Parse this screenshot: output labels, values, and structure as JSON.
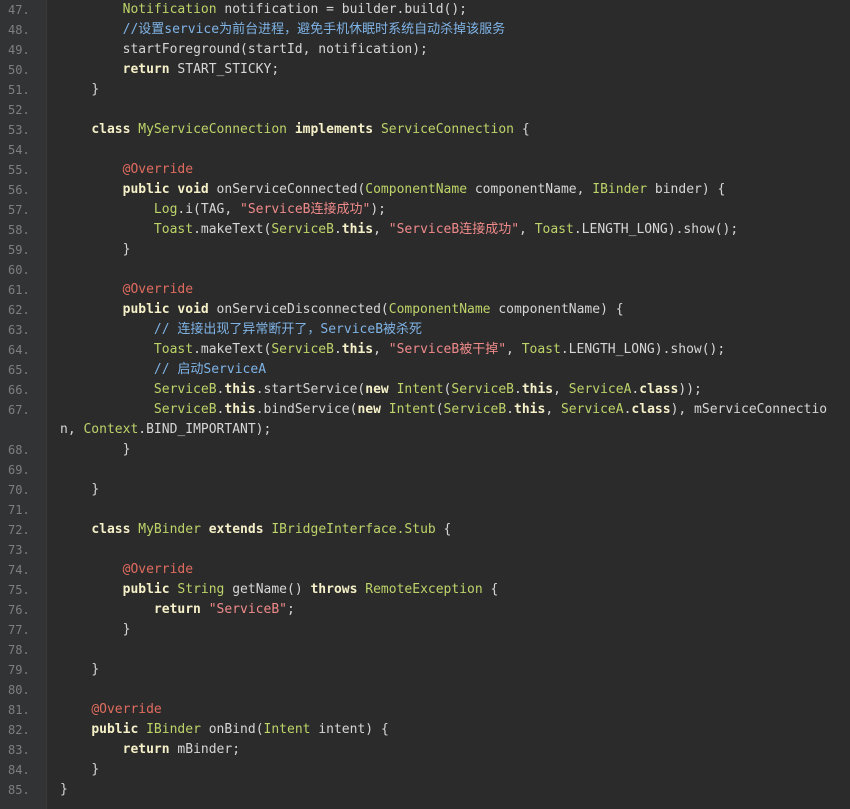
{
  "lines": [
    {
      "n": "47.",
      "indent": 2,
      "tokens": [
        [
          "t",
          "Notification"
        ],
        [
          "p",
          " notification = builder.build();"
        ]
      ]
    },
    {
      "n": "48.",
      "indent": 2,
      "tokens": [
        [
          "c",
          "//设置service为前台进程，避免手机休眠时系统自动杀掉该服务"
        ]
      ]
    },
    {
      "n": "49.",
      "indent": 2,
      "tokens": [
        [
          "p",
          "startForeground(startId, notification);"
        ]
      ]
    },
    {
      "n": "50.",
      "indent": 2,
      "tokens": [
        [
          "k",
          "return"
        ],
        [
          "p",
          " START_STICKY;"
        ]
      ]
    },
    {
      "n": "51.",
      "indent": 1,
      "tokens": [
        [
          "p",
          "}"
        ]
      ]
    },
    {
      "n": "52.",
      "indent": 0,
      "tokens": []
    },
    {
      "n": "53.",
      "indent": 1,
      "tokens": [
        [
          "k",
          "class"
        ],
        [
          "p",
          " "
        ],
        [
          "t",
          "MyServiceConnection"
        ],
        [
          "p",
          " "
        ],
        [
          "k",
          "implements"
        ],
        [
          "p",
          " "
        ],
        [
          "t",
          "ServiceConnection"
        ],
        [
          "p",
          " {"
        ]
      ]
    },
    {
      "n": "54.",
      "indent": 0,
      "tokens": []
    },
    {
      "n": "55.",
      "indent": 2,
      "tokens": [
        [
          "a",
          "@Override"
        ]
      ]
    },
    {
      "n": "56.",
      "indent": 2,
      "tokens": [
        [
          "k",
          "public"
        ],
        [
          "p",
          " "
        ],
        [
          "k",
          "void"
        ],
        [
          "p",
          " onServiceConnected("
        ],
        [
          "t",
          "ComponentName"
        ],
        [
          "p",
          " componentName, "
        ],
        [
          "t",
          "IBinder"
        ],
        [
          "p",
          " binder) {"
        ]
      ]
    },
    {
      "n": "57.",
      "indent": 3,
      "tokens": [
        [
          "t",
          "Log"
        ],
        [
          "p",
          ".i(TAG, "
        ],
        [
          "s",
          "\"ServiceB连接成功\""
        ],
        [
          "p",
          ");"
        ]
      ]
    },
    {
      "n": "58.",
      "indent": 3,
      "tokens": [
        [
          "t",
          "Toast"
        ],
        [
          "p",
          ".makeText("
        ],
        [
          "t",
          "ServiceB"
        ],
        [
          "p",
          "."
        ],
        [
          "k",
          "this"
        ],
        [
          "p",
          ", "
        ],
        [
          "s",
          "\"ServiceB连接成功\""
        ],
        [
          "p",
          ", "
        ],
        [
          "t",
          "Toast"
        ],
        [
          "p",
          ".LENGTH_LONG).show();"
        ]
      ]
    },
    {
      "n": "59.",
      "indent": 2,
      "tokens": [
        [
          "p",
          "}"
        ]
      ]
    },
    {
      "n": "60.",
      "indent": 0,
      "tokens": []
    },
    {
      "n": "61.",
      "indent": 2,
      "tokens": [
        [
          "a",
          "@Override"
        ]
      ]
    },
    {
      "n": "62.",
      "indent": 2,
      "tokens": [
        [
          "k",
          "public"
        ],
        [
          "p",
          " "
        ],
        [
          "k",
          "void"
        ],
        [
          "p",
          " onServiceDisconnected("
        ],
        [
          "t",
          "ComponentName"
        ],
        [
          "p",
          " componentName) {"
        ]
      ]
    },
    {
      "n": "63.",
      "indent": 3,
      "tokens": [
        [
          "c",
          "// 连接出现了异常断开了，ServiceB被杀死"
        ]
      ]
    },
    {
      "n": "64.",
      "indent": 3,
      "tokens": [
        [
          "t",
          "Toast"
        ],
        [
          "p",
          ".makeText("
        ],
        [
          "t",
          "ServiceB"
        ],
        [
          "p",
          "."
        ],
        [
          "k",
          "this"
        ],
        [
          "p",
          ", "
        ],
        [
          "s",
          "\"ServiceB被干掉\""
        ],
        [
          "p",
          ", "
        ],
        [
          "t",
          "Toast"
        ],
        [
          "p",
          ".LENGTH_LONG).show();"
        ]
      ]
    },
    {
      "n": "65.",
      "indent": 3,
      "tokens": [
        [
          "c",
          "// 启动ServiceA"
        ]
      ]
    },
    {
      "n": "66.",
      "indent": 3,
      "tokens": [
        [
          "t",
          "ServiceB"
        ],
        [
          "p",
          "."
        ],
        [
          "k",
          "this"
        ],
        [
          "p",
          ".startService("
        ],
        [
          "k",
          "new"
        ],
        [
          "p",
          " "
        ],
        [
          "t",
          "Intent"
        ],
        [
          "p",
          "("
        ],
        [
          "t",
          "ServiceB"
        ],
        [
          "p",
          "."
        ],
        [
          "k",
          "this"
        ],
        [
          "p",
          ", "
        ],
        [
          "t",
          "ServiceA"
        ],
        [
          "p",
          "."
        ],
        [
          "k",
          "class"
        ],
        [
          "p",
          "));"
        ]
      ]
    },
    {
      "n": "67.",
      "indent": 3,
      "wrapped": true,
      "tokens": [
        [
          "t",
          "ServiceB"
        ],
        [
          "p",
          "."
        ],
        [
          "k",
          "this"
        ],
        [
          "p",
          ".bindService("
        ],
        [
          "k",
          "new"
        ],
        [
          "p",
          " "
        ],
        [
          "t",
          "Intent"
        ],
        [
          "p",
          "("
        ],
        [
          "t",
          "ServiceB"
        ],
        [
          "p",
          "."
        ],
        [
          "k",
          "this"
        ],
        [
          "p",
          ", "
        ],
        [
          "t",
          "ServiceA"
        ],
        [
          "p",
          "."
        ],
        [
          "k",
          "class"
        ],
        [
          "p",
          "), mServiceConnection, "
        ],
        [
          "t",
          "Context"
        ],
        [
          "p",
          ".BIND_IMPORTANT);"
        ]
      ]
    },
    {
      "n": "68.",
      "indent": 2,
      "tokens": [
        [
          "p",
          "}"
        ]
      ]
    },
    {
      "n": "69.",
      "indent": 0,
      "tokens": []
    },
    {
      "n": "70.",
      "indent": 1,
      "tokens": [
        [
          "p",
          "}"
        ]
      ]
    },
    {
      "n": "71.",
      "indent": 0,
      "tokens": []
    },
    {
      "n": "72.",
      "indent": 1,
      "tokens": [
        [
          "k",
          "class"
        ],
        [
          "p",
          " "
        ],
        [
          "t",
          "MyBinder"
        ],
        [
          "p",
          " "
        ],
        [
          "k",
          "extends"
        ],
        [
          "p",
          " "
        ],
        [
          "t",
          "IBridgeInterface.Stub"
        ],
        [
          "p",
          " {"
        ]
      ]
    },
    {
      "n": "73.",
      "indent": 0,
      "tokens": []
    },
    {
      "n": "74.",
      "indent": 2,
      "tokens": [
        [
          "a",
          "@Override"
        ]
      ]
    },
    {
      "n": "75.",
      "indent": 2,
      "tokens": [
        [
          "k",
          "public"
        ],
        [
          "p",
          " "
        ],
        [
          "t",
          "String"
        ],
        [
          "p",
          " getName() "
        ],
        [
          "k",
          "throws"
        ],
        [
          "p",
          " "
        ],
        [
          "t",
          "RemoteException"
        ],
        [
          "p",
          " {"
        ]
      ]
    },
    {
      "n": "76.",
      "indent": 3,
      "tokens": [
        [
          "k",
          "return"
        ],
        [
          "p",
          " "
        ],
        [
          "s",
          "\"ServiceB\""
        ],
        [
          "p",
          ";"
        ]
      ]
    },
    {
      "n": "77.",
      "indent": 2,
      "tokens": [
        [
          "p",
          "}"
        ]
      ]
    },
    {
      "n": "78.",
      "indent": 0,
      "tokens": []
    },
    {
      "n": "79.",
      "indent": 1,
      "tokens": [
        [
          "p",
          "}"
        ]
      ]
    },
    {
      "n": "80.",
      "indent": 0,
      "tokens": []
    },
    {
      "n": "81.",
      "indent": 1,
      "tokens": [
        [
          "a",
          "@Override"
        ]
      ]
    },
    {
      "n": "82.",
      "indent": 1,
      "tokens": [
        [
          "k",
          "public"
        ],
        [
          "p",
          " "
        ],
        [
          "t",
          "IBinder"
        ],
        [
          "p",
          " onBind("
        ],
        [
          "t",
          "Intent"
        ],
        [
          "p",
          " intent) {"
        ]
      ]
    },
    {
      "n": "83.",
      "indent": 2,
      "tokens": [
        [
          "k",
          "return"
        ],
        [
          "p",
          " mBinder;"
        ]
      ]
    },
    {
      "n": "84.",
      "indent": 1,
      "tokens": [
        [
          "p",
          "}"
        ]
      ]
    },
    {
      "n": "85.",
      "indent": 0,
      "tokens": [
        [
          "p",
          "}"
        ]
      ]
    }
  ]
}
